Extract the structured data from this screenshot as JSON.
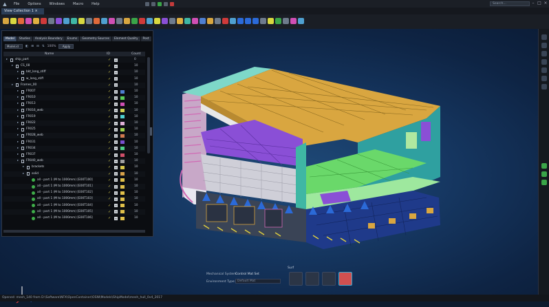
{
  "app": {
    "menu": [
      "File",
      "Options",
      "Windows",
      "Macro",
      "Help"
    ],
    "search_placeholder": "Search..."
  },
  "tab": {
    "label": "View Collection 1"
  },
  "panel": {
    "tabs": [
      "Model",
      "Studies",
      "Analysis Boundary",
      "Enums",
      "Geometry Sources",
      "Element Quality",
      "Post"
    ],
    "filter": {
      "select": "Model.id",
      "percent": "100%",
      "button": "Apply"
    },
    "columns": {
      "name": "Name",
      "col2": "ID",
      "count": "Count"
    },
    "rows": [
      {
        "indent": 0,
        "label": "ship_part",
        "count": "0",
        "swatch": ""
      },
      {
        "indent": 1,
        "label": "CS_08",
        "count": "10",
        "swatch": ""
      },
      {
        "indent": 2,
        "label": "bkt_long_stiff",
        "count": "10",
        "swatch": ""
      },
      {
        "indent": 2,
        "label": "w_long_stiff",
        "count": "10",
        "swatch": ""
      },
      {
        "indent": 1,
        "label": "Frames_00",
        "count": "10",
        "swatch": ""
      },
      {
        "indent": 2,
        "label": "FR007",
        "count": "10",
        "swatch": "#4f7fd0"
      },
      {
        "indent": 2,
        "label": "FR010",
        "count": "10",
        "swatch": "#5ad05a"
      },
      {
        "indent": 2,
        "label": "FR013",
        "count": "10",
        "swatch": "#d04fb4"
      },
      {
        "indent": 2,
        "label": "FR016_web",
        "count": "10",
        "swatch": "#d0d04f"
      },
      {
        "indent": 2,
        "label": "FR019",
        "count": "10",
        "swatch": "#4fd0d0"
      },
      {
        "indent": 2,
        "label": "FR022",
        "count": "10",
        "swatch": "#e0b0d8"
      },
      {
        "indent": 2,
        "label": "FR025",
        "count": "10",
        "swatch": "#9fd04f"
      },
      {
        "indent": 2,
        "label": "FR028_web",
        "count": "10",
        "swatch": "#d07a4f"
      },
      {
        "indent": 2,
        "label": "FR031",
        "count": "10",
        "swatch": "#7a4fd0"
      },
      {
        "indent": 2,
        "label": "FR034",
        "count": "10",
        "swatch": "#4fd08a"
      },
      {
        "indent": 2,
        "label": "FR037",
        "count": "10",
        "swatch": "#d04f6a"
      },
      {
        "indent": 2,
        "label": "FR040_web",
        "count": "10",
        "swatch": "#a0a0a0"
      },
      {
        "indent": 3,
        "label": "brackets",
        "count": "10",
        "swatch": "#d8c64a"
      },
      {
        "indent": 3,
        "label": "solid",
        "count": "10",
        "swatch": "#d8a24a"
      },
      {
        "indent": 4,
        "label": "all - part 1 (M to 1000mm) [E00T100]",
        "count": "10",
        "swatch": "#e0c04a",
        "dot": true
      },
      {
        "indent": 4,
        "label": "all - part 1 (M to 1000mm) [E00T101]",
        "count": "10",
        "swatch": "#e0c04a",
        "dot": true
      },
      {
        "indent": 4,
        "label": "all - part 1 (M to 1000mm) [E00T102]",
        "count": "10",
        "swatch": "#e0c04a",
        "dot": true
      },
      {
        "indent": 4,
        "label": "all - part 1 (M to 1000mm) [E00T103]",
        "count": "10",
        "swatch": "#e0c04a",
        "dot": true
      },
      {
        "indent": 4,
        "label": "all - part 1 (M to 1000mm) [E00T104]",
        "count": "10",
        "swatch": "#e0c04a",
        "dot": true
      },
      {
        "indent": 4,
        "label": "all - part 1 (M to 1000mm) [E00T105]",
        "count": "10",
        "swatch": "#e0c04a",
        "dot": true
      },
      {
        "indent": 4,
        "label": "all - part 1 (M to 1000mm) [E00T106]",
        "count": "10",
        "swatch": "#e0c04a",
        "dot": true
      }
    ]
  },
  "bottom": {
    "mechanical_label": "Mechanical System:",
    "mechanical_value": "Control Mat Set",
    "environment_label": "Environment Type:",
    "environment_value": "Default Mat",
    "section_label": "Surf"
  },
  "status": {
    "text": "Opened: mesh_140 from D:\\Software\\NFX\\OpenContainer\\OSNI\\Models\\ShipModel\\mesh_hull_0v4_2017"
  },
  "colors": {
    "deck": "#d9a640",
    "purple": "#8a4fd6",
    "teal": "#3fb7a4",
    "green": "#6ad86a",
    "navy": "#1f3a8a",
    "accent": "#3a4a63"
  }
}
